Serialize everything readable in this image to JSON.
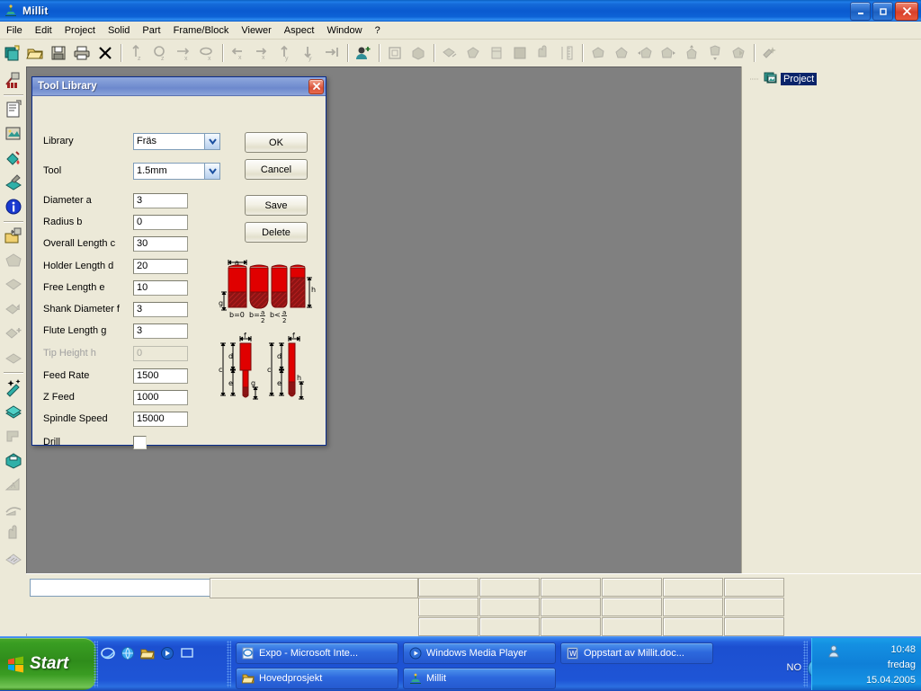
{
  "window": {
    "title": "Millit",
    "icon": "millit-app-icon",
    "buttons": {
      "minimize": "_",
      "maximize": "❐",
      "close": "✕"
    }
  },
  "menu": {
    "items": [
      "File",
      "Edit",
      "Project",
      "Solid",
      "Part",
      "Frame/Block",
      "Viewer",
      "Aspect",
      "Window",
      "?"
    ]
  },
  "toolbar": {
    "groups": [
      {
        "icons": [
          "new-project-icon",
          "open-folder-icon",
          "save-disk-icon",
          "print-icon",
          "delete-x-icon"
        ]
      },
      {
        "icons": [
          "mirror-z-icon",
          "rotate-z-icon",
          "mirror-x-icon",
          "rotate-x-icon"
        ]
      },
      {
        "icons": [
          "move-left-x-icon",
          "move-right-x-icon",
          "move-up-y-icon",
          "move-down-y-icon",
          "snap-right-icon"
        ]
      },
      {
        "icons": [
          "user-add-icon"
        ]
      },
      {
        "icons": [
          "frame-icon",
          "block-icon"
        ]
      },
      {
        "icons": [
          "solid-edit-icon",
          "solid-burst-icon",
          "solid-box-icon",
          "fill-square-icon",
          "pointer-solid-icon",
          "measure-ruler-icon"
        ]
      },
      {
        "icons": [
          "shape-a-icon",
          "shape-b-icon",
          "shape-left-icon",
          "shape-right-icon",
          "shape-top-icon",
          "shape-bottom-icon",
          "shape-combine-icon"
        ]
      },
      {
        "icons": [
          "tool-library-icon"
        ]
      }
    ]
  },
  "left_toolbar": {
    "items": [
      {
        "name": "tool-library-icon"
      },
      {
        "name": "document-properties-icon"
      },
      {
        "name": "image-frame-icon"
      },
      {
        "name": "paint-bucket-icon"
      },
      {
        "name": "layer-paint-icon"
      },
      {
        "name": "info-icon"
      },
      {
        "name": "open-part-icon"
      },
      {
        "name": "solid-gray-a-icon"
      },
      {
        "name": "solid-gray-b-icon"
      },
      {
        "name": "solid-transform-icon"
      },
      {
        "name": "solid-add-icon"
      },
      {
        "name": "solid-plain-icon"
      },
      {
        "name": "magic-wand-icon"
      },
      {
        "name": "layers-teal-icon"
      },
      {
        "name": "flag-gray-icon"
      },
      {
        "name": "toolbox-teal-icon"
      },
      {
        "name": "ramp-a-icon"
      },
      {
        "name": "curve-edit-icon"
      },
      {
        "name": "pointer-gray-icon"
      },
      {
        "name": "hatch-pattern-icon"
      }
    ]
  },
  "project_panel": {
    "tree": [
      {
        "label": "Project",
        "icon": "project-node-icon",
        "selected": true
      }
    ]
  },
  "status_bar": {
    "input_value": "",
    "cells": [
      "",
      "",
      "",
      "",
      "",
      "",
      "",
      "",
      "",
      "",
      "",
      "",
      "",
      "",
      "",
      "",
      "",
      ""
    ]
  },
  "dialog": {
    "title": "Tool Library",
    "close_label": "✕",
    "fields": [
      {
        "label": "Library",
        "type": "combo",
        "value": "Fräs",
        "disabled": false
      },
      {
        "label": "Tool",
        "type": "combo",
        "value": "1.5mm",
        "disabled": false
      },
      {
        "label": "Diameter a",
        "type": "text",
        "value": "3",
        "disabled": false
      },
      {
        "label": "Radius b",
        "type": "text",
        "value": "0",
        "disabled": false
      },
      {
        "label": "Overall Length c",
        "type": "text",
        "value": "30",
        "disabled": false
      },
      {
        "label": "Holder Length d",
        "type": "text",
        "value": "20",
        "disabled": false
      },
      {
        "label": "Free Length e",
        "type": "text",
        "value": "10",
        "disabled": false
      },
      {
        "label": "Shank Diameter f",
        "type": "text",
        "value": "3",
        "disabled": false
      },
      {
        "label": "Flute Length g",
        "type": "text",
        "value": "3",
        "disabled": false
      },
      {
        "label": "Tip Height h",
        "type": "text",
        "value": "0",
        "disabled": true
      },
      {
        "label": "Feed Rate",
        "type": "text",
        "value": "1500",
        "disabled": false
      },
      {
        "label": "Z Feed",
        "type": "text",
        "value": "1000",
        "disabled": false
      },
      {
        "label": "Spindle Speed",
        "type": "text",
        "value": "15000",
        "disabled": false
      },
      {
        "label": "Drill",
        "type": "checkbox",
        "value": "",
        "disabled": false,
        "checked": false
      }
    ],
    "buttons": [
      {
        "label": "OK",
        "name": "ok-button"
      },
      {
        "label": "Cancel",
        "name": "cancel-button"
      },
      {
        "label": "Save",
        "name": "save-button"
      },
      {
        "label": "Delete",
        "name": "delete-button"
      }
    ],
    "diagram": {
      "top_captions": [
        "b=0",
        "b=a/2",
        "b<a/2"
      ],
      "labels": [
        "a",
        "g",
        "h",
        "f",
        "c",
        "d",
        "e"
      ]
    },
    "colors": {
      "tool_red": "#e00000",
      "tool_dark_red": "#8c1010",
      "title_gradient": "#7b96d4"
    }
  },
  "taskbar": {
    "start_label": "Start",
    "quick_launch": [
      "internet-explorer-icon",
      "browser-icon",
      "folder-icon",
      "media-player-icon",
      "show-desktop-icon"
    ],
    "items": [
      {
        "label": "Expo - Microsoft Inte...",
        "icon": "ie-doc-icon"
      },
      {
        "label": "Windows Media Player",
        "icon": "media-player-icon"
      },
      {
        "label": "Oppstart av Millit.doc...",
        "icon": "word-doc-icon"
      },
      {
        "label": "Hovedprosjekt",
        "icon": "folder-icon"
      },
      {
        "label": "Millit",
        "icon": "millit-app-icon"
      }
    ],
    "tray": {
      "language": "NO",
      "chevron": "«",
      "user_icon": "user-account-icon",
      "time": "10:48",
      "day": "fredag",
      "date": "15.04.2005"
    }
  },
  "canvas": {
    "background": "#808080"
  }
}
